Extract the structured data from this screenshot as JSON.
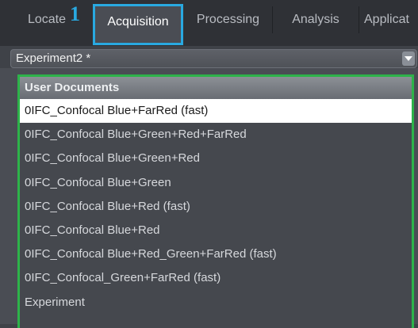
{
  "tabs": [
    {
      "label": "Locate"
    },
    {
      "label": "Acquisition",
      "active": true
    },
    {
      "label": "Processing"
    },
    {
      "label": "Analysis"
    },
    {
      "label": "Applicat"
    }
  ],
  "annotation": {
    "step_number": "1"
  },
  "experiment_dropdown": {
    "value": "Experiment2 *"
  },
  "list": {
    "header": "User Documents",
    "items": [
      {
        "label": "0IFC_Confocal Blue+FarRed (fast)",
        "selected": true
      },
      {
        "label": "0IFC_Confocal Blue+Green+Red+FarRed"
      },
      {
        "label": "0IFC_Confocal Blue+Green+Red"
      },
      {
        "label": "0IFC_Confocal Blue+Green"
      },
      {
        "label": "0IFC_Confocal Blue+Red (fast)"
      },
      {
        "label": "0IFC_Confocal Blue+Red"
      },
      {
        "label": "0IFC_Confocal Blue+Red_Green+FarRed (fast)"
      },
      {
        "label": "0IFC_Confocal_Green+FarRed (fast)"
      },
      {
        "label": "Experiment"
      }
    ]
  },
  "colors": {
    "highlight_tab_border": "#29a9e1",
    "list_border": "#2db34a",
    "step_number": "#29a9e1"
  }
}
